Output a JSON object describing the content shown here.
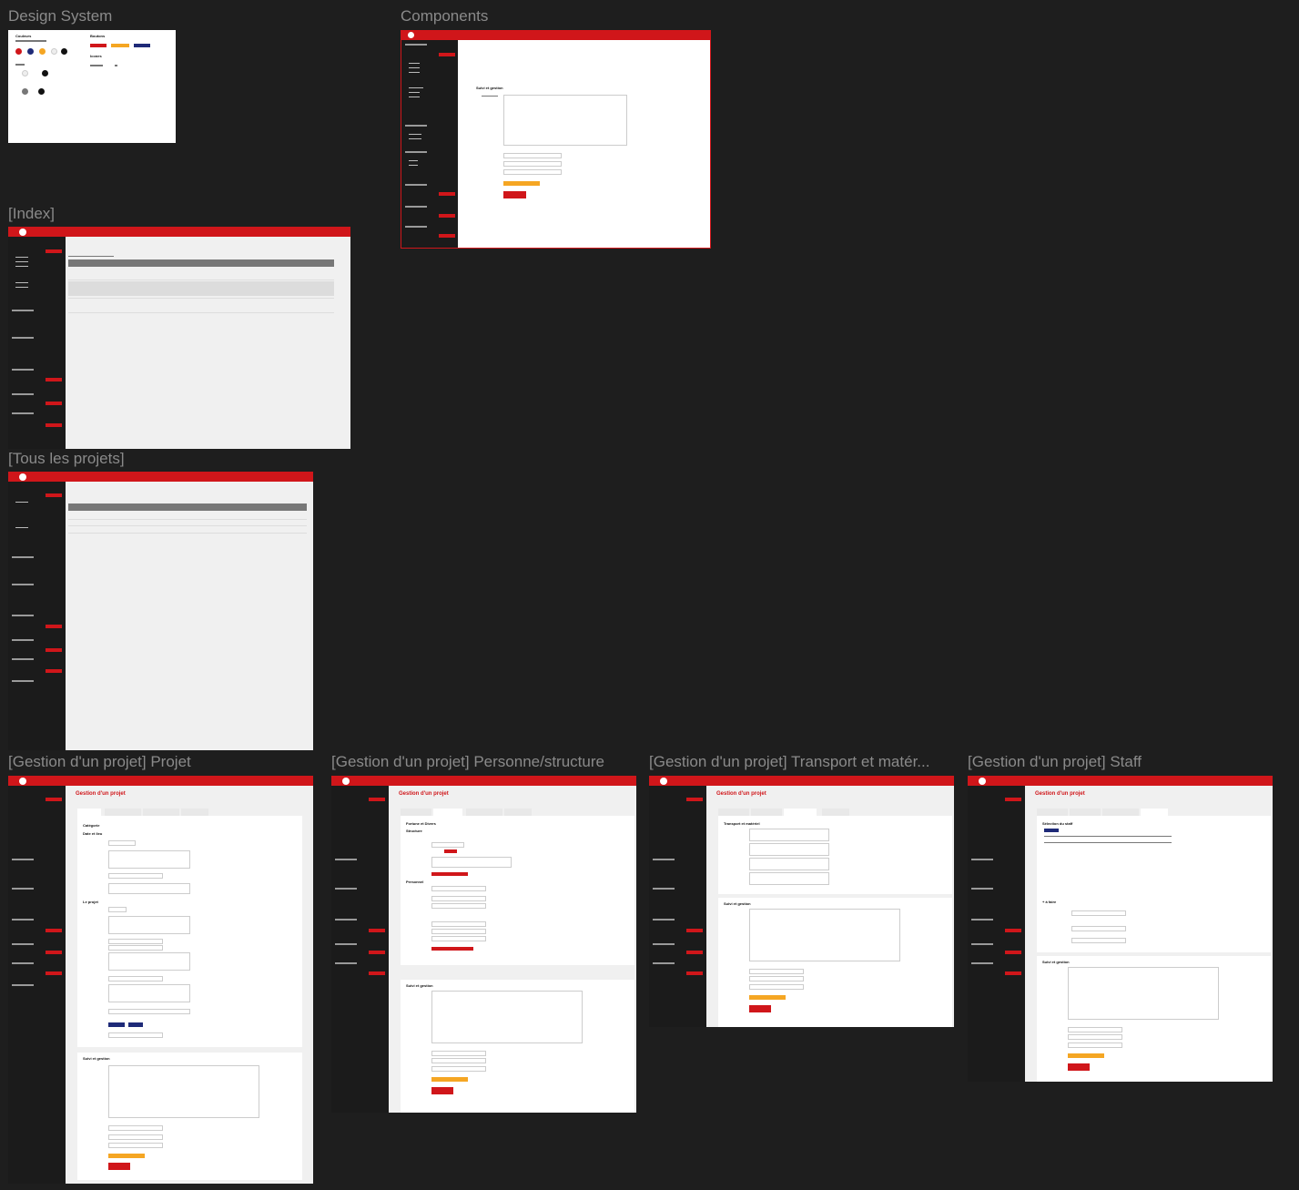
{
  "frames": {
    "design_system": {
      "title": "Design System"
    },
    "components": {
      "title": "Components"
    },
    "index": {
      "title": "[Index]"
    },
    "tous_projets": {
      "title": "[Tous les projets]"
    },
    "gestion_projet": {
      "title": "[Gestion d'un projet] Projet"
    },
    "gestion_personne": {
      "title": "[Gestion d'un projet] Personne/structure"
    },
    "gestion_transport": {
      "title": "[Gestion d'un projet] Transport et matér..."
    },
    "gestion_staff": {
      "title": "[Gestion d'un projet] Staff"
    }
  },
  "design_system": {
    "couleurs": "Couleurs",
    "boutons": "Boutons",
    "icones": "Icones",
    "colors": [
      "#d0161a",
      "#1e2a78",
      "#f5a623",
      "#eeeeee",
      "#111111"
    ]
  },
  "components": {
    "section_title": "Suivi et gestion",
    "save_button": "Enregistrer"
  },
  "gestion": {
    "page_title": "Gestion d'un projet",
    "tabs": [
      "Projet",
      "Personne/structure",
      "Transport et matériel",
      "Staff"
    ],
    "save_button": "Enregistrer",
    "suivi_title": "Suivi et gestion"
  },
  "gestion_projet": {
    "section_categorie": "Catégorie",
    "section_dates": "Date et lieu",
    "section_projet": "Le projet"
  },
  "gestion_personne": {
    "section_fortune": "Fortune et Divers",
    "section_structure": "Structure",
    "section_personnel": "Personnel"
  },
  "gestion_transport": {
    "section_transport": "Transport et matériel"
  },
  "gestion_staff": {
    "section_selection": "Sélection du staff",
    "section_a_faire": "+ à faire"
  },
  "colors": {
    "brand_red": "#d0161a",
    "sidebar": "#1b1b1b",
    "canvas": "#1e1e1e",
    "orange": "#f5a623",
    "navy": "#1e2a78"
  }
}
